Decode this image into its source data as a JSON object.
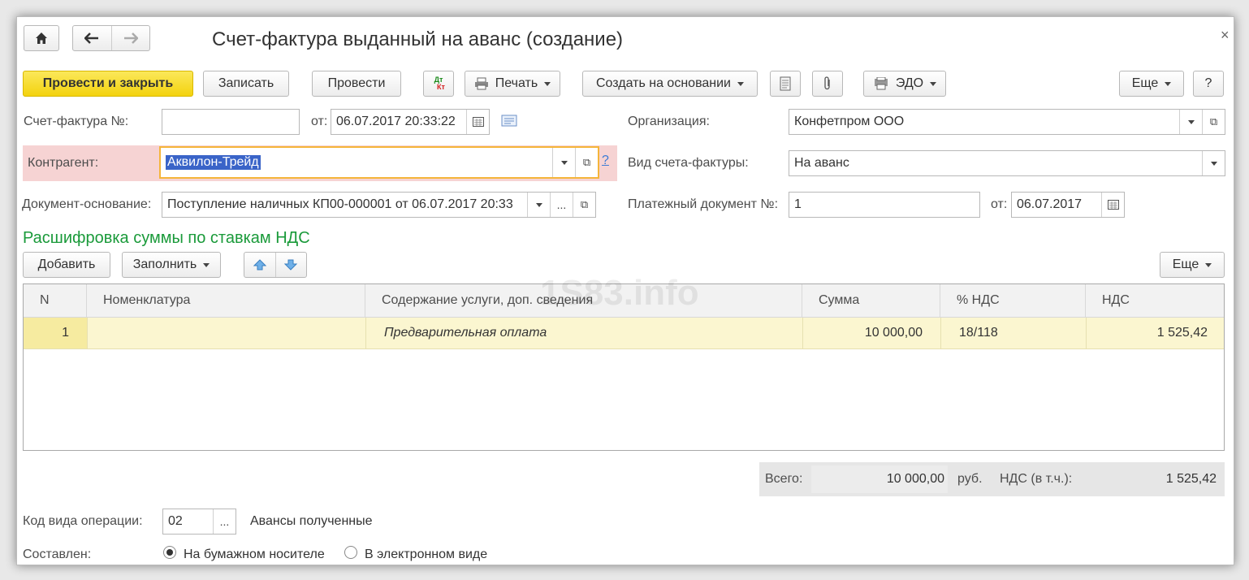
{
  "window": {
    "title": "Счет-фактура выданный на аванс (создание)",
    "close_symbol": "×"
  },
  "toolbar": {
    "post_close": "Провести и закрыть",
    "save": "Записать",
    "post": "Провести",
    "dt_kt": "Дт\nКт",
    "print": "Печать",
    "create_based": "Создать на основании",
    "edo": "ЭДО",
    "more": "Еще",
    "help": "?"
  },
  "form": {
    "invoice_no_label": "Счет-фактура №:",
    "invoice_no_value": "",
    "date_from_label": "от:",
    "date_value": "06.07.2017 20:33:22",
    "org_label": "Организация:",
    "org_value": "Конфетпром ООО",
    "contractor_label": "Контрагент:",
    "contractor_value": "Аквилон-Трейд",
    "contractor_help": "?",
    "invoice_type_label": "Вид счета-фактуры:",
    "invoice_type_value": "На аванс",
    "base_doc_label": "Документ-основание:",
    "base_doc_value": "Поступление наличных КП00-000001 от 06.07.2017 20:33",
    "pay_doc_label": "Платежный документ №:",
    "pay_doc_value": "1",
    "pay_date_label": "от:",
    "pay_date_value": "06.07.2017"
  },
  "section": {
    "title": "Расшифровка суммы по ставкам НДС",
    "add": "Добавить",
    "fill": "Заполнить",
    "more": "Еще"
  },
  "table": {
    "headers": [
      "N",
      "Номенклатура",
      "Содержание услуги, доп. сведения",
      "Сумма",
      "% НДС",
      "НДС"
    ],
    "rows": [
      {
        "n": "1",
        "nomenclature": "",
        "content": "Предварительная оплата",
        "sum": "10 000,00",
        "vat_rate": "18/118",
        "vat": "1 525,42"
      }
    ]
  },
  "watermark": "1S83.info",
  "totals": {
    "total_label": "Всего:",
    "total_value": "10 000,00",
    "currency": "руб.",
    "vat_label": "НДС (в т.ч.):",
    "vat_value": "1 525,42"
  },
  "footer": {
    "op_code_label": "Код вида операции:",
    "op_code_value": "02",
    "op_code_btn": "...",
    "op_code_desc": "Авансы полученные",
    "composed_label": "Составлен:",
    "radio_paper": "На бумажном носителе",
    "radio_electronic": "В электронном виде"
  },
  "colors": {
    "primary": "#f3d20e",
    "accent_green": "#1a9a3a",
    "row_highlight": "#fbf6d0",
    "error_bg": "#f6d3d3",
    "focus_border": "#f5b53a"
  }
}
